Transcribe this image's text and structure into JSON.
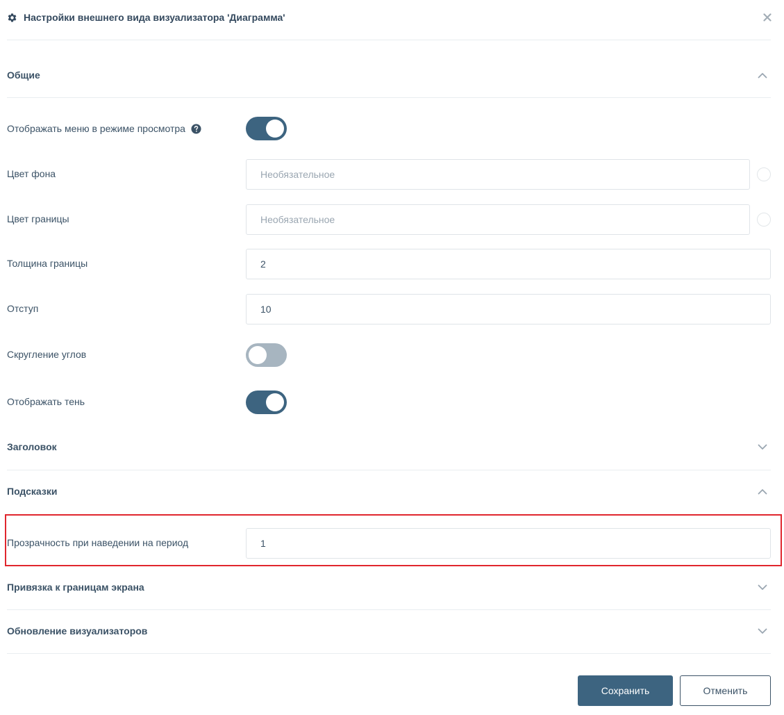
{
  "header": {
    "title": "Настройки внешнего вида визуализатора 'Диаграмма'",
    "icon": "gear-icon",
    "close_icon": "close-icon"
  },
  "sections": {
    "general": {
      "title": "Общие",
      "expanded": true
    },
    "heading": {
      "title": "Заголовок",
      "expanded": false
    },
    "tooltips": {
      "title": "Подсказки",
      "expanded": true
    },
    "snap": {
      "title": "Привязка к границам экрана",
      "expanded": false
    },
    "refresh": {
      "title": "Обновление визуализаторов",
      "expanded": false
    }
  },
  "general": {
    "show_menu": {
      "label": "Отображать меню в режиме просмотра",
      "value": true,
      "help_icon": "question-circle-icon"
    },
    "bg_color": {
      "label": "Цвет фона",
      "placeholder": "Необязательное",
      "value": ""
    },
    "border_color": {
      "label": "Цвет границы",
      "placeholder": "Необязательное",
      "value": ""
    },
    "border_width": {
      "label": "Толщина границы",
      "value": "2"
    },
    "padding": {
      "label": "Отступ",
      "value": "10"
    },
    "rounded": {
      "label": "Скругление углов",
      "value": false
    },
    "shadow": {
      "label": "Отображать тень",
      "value": true
    }
  },
  "tooltips": {
    "opacity": {
      "label": "Прозрачность при наведении на период",
      "value": "1"
    }
  },
  "footer": {
    "save_label": "Сохранить",
    "cancel_label": "Отменить"
  },
  "colors": {
    "primary": "#3d6480",
    "toggle_off": "#a7b5c0",
    "text": "#3b5266",
    "highlight": "#e0262d"
  }
}
